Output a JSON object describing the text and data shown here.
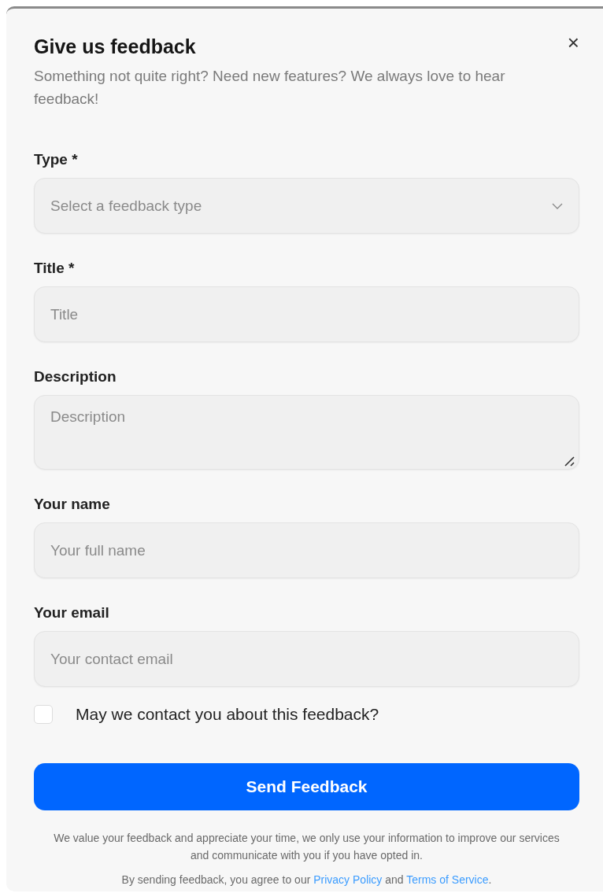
{
  "dialog": {
    "title": "Give us feedback",
    "close": "×",
    "subtitle": "Something not quite right? Need new features? We always love to hear feedback!"
  },
  "fields": [
    {
      "kind": "select",
      "label": "Type *",
      "placeholder": "Select a feedback type"
    },
    {
      "kind": "input",
      "label": "Title *",
      "placeholder": "Title"
    },
    {
      "kind": "textarea",
      "label": "Description",
      "placeholder": "Description"
    },
    {
      "kind": "input",
      "label": "Your name",
      "placeholder": "Your full name"
    },
    {
      "kind": "input",
      "label": "Your email",
      "placeholder": "Your contact email"
    }
  ],
  "consent": {
    "label": "May we contact you about this feedback?",
    "checked": false
  },
  "submit": "Send Feedback",
  "notice": "We value your feedback and appreciate your time, we only use your information to improve our services and communicate with you if you have opted in.",
  "legal": {
    "before": "By sending feedback, you agree to our",
    "privacy": "Privacy Policy",
    "middle": "and",
    "terms": "Terms of Service",
    "after": "."
  }
}
